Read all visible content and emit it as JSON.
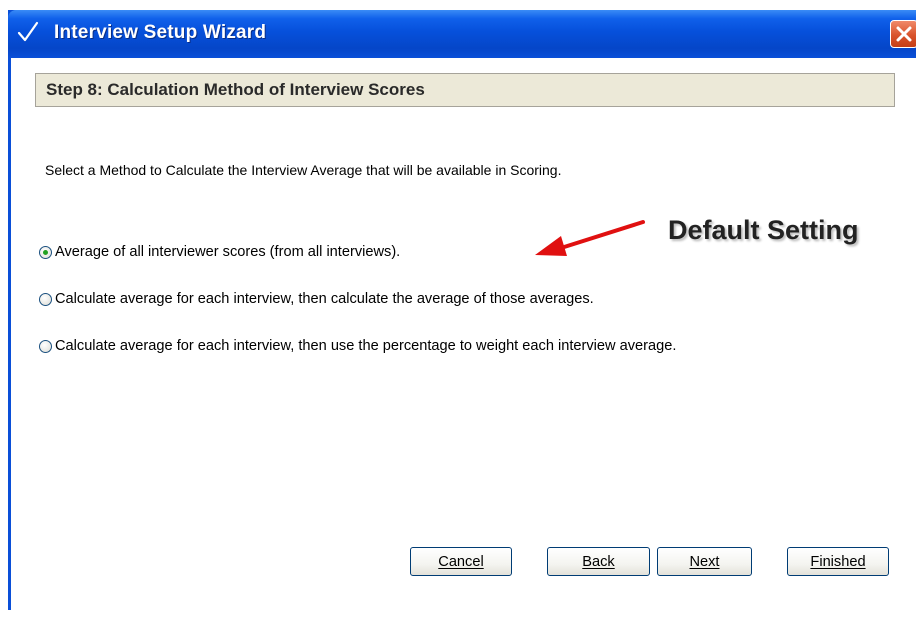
{
  "window": {
    "title": "Interview Setup Wizard",
    "title_icon": "check-icon",
    "close_icon": "close-icon"
  },
  "step": {
    "title": "Step 8:  Calculation Method of Interview Scores"
  },
  "instruction": "Select a Method to Calculate the Interview Average that will be available in Scoring.",
  "options": [
    {
      "label": "Average of all interviewer scores (from all interviews).",
      "selected": true
    },
    {
      "label": "Calculate average for each interview, then calculate the average of those averages.",
      "selected": false
    },
    {
      "label": "Calculate average for each interview, then use the percentage to weight each interview average.",
      "selected": false
    }
  ],
  "annotation": {
    "label": "Default Setting",
    "arrow_color": "#e01010"
  },
  "buttons": {
    "cancel": "Cancel",
    "back": "Back",
    "next": "Next",
    "finished": "Finished"
  },
  "colors": {
    "titlebar": "#0a4fd8",
    "close_button": "#d9532c",
    "header_bg": "#ece9d8",
    "radio_selected": "#21a121"
  }
}
